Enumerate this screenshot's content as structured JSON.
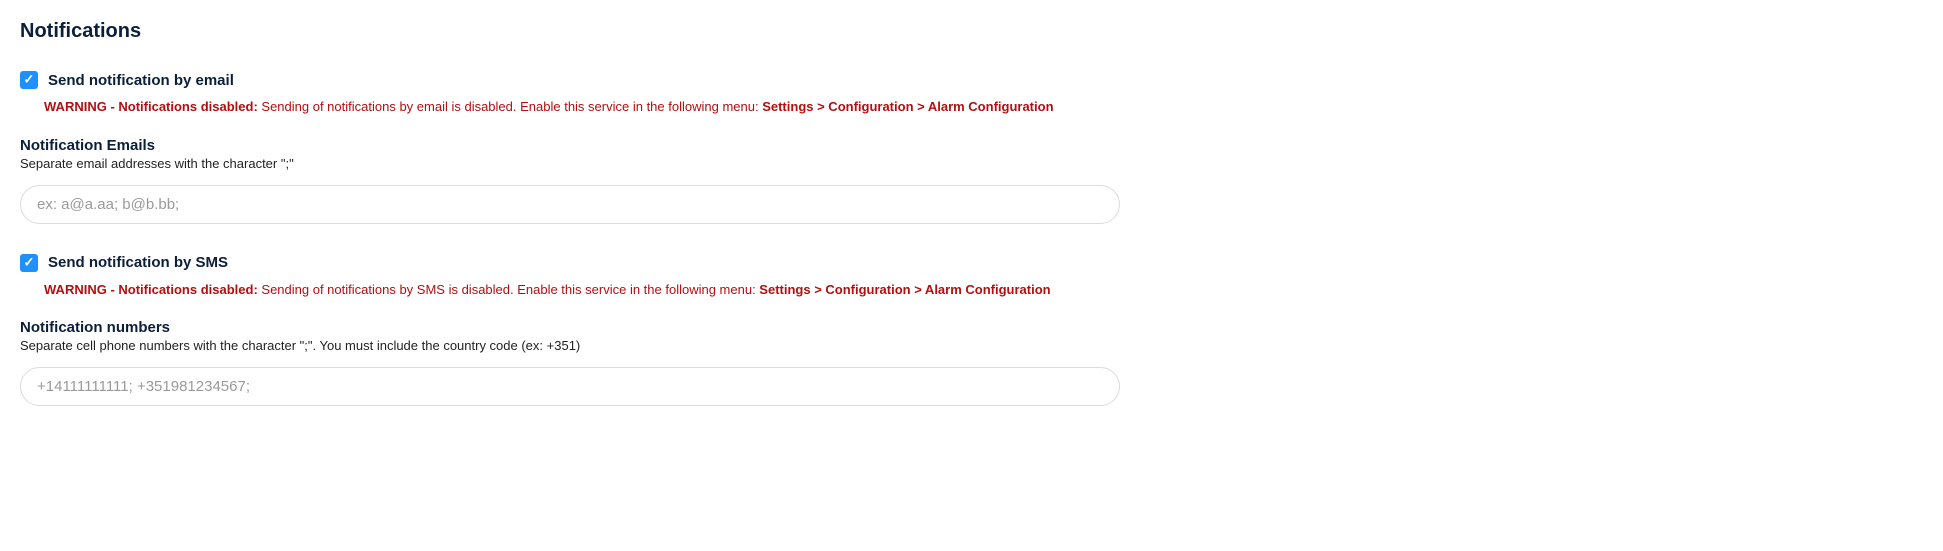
{
  "title": "Notifications",
  "email": {
    "checkbox_label": "Send notification by email",
    "warning_prefix": "WARNING - Notifications disabled:",
    "warning_body": " Sending of notifications by email is disabled. Enable this service in the following menu: ",
    "warning_path": "Settings > Configuration > Alarm Configuration",
    "field_title": "Notification Emails",
    "hint": "Separate email addresses with the character \";\"",
    "placeholder": "ex: a@a.aa; b@b.bb;",
    "value": ""
  },
  "sms": {
    "checkbox_label": "Send notification by SMS",
    "warning_prefix": "WARNING - Notifications disabled:",
    "warning_body": " Sending of notifications by SMS is disabled. Enable this service in the following menu: ",
    "warning_path": "Settings > Configuration > Alarm Configuration",
    "field_title": "Notification numbers",
    "hint": "Separate cell phone numbers with the character \";\". You must include the country code (ex: +351)",
    "placeholder": "+14111111111; +351981234567;",
    "value": ""
  }
}
